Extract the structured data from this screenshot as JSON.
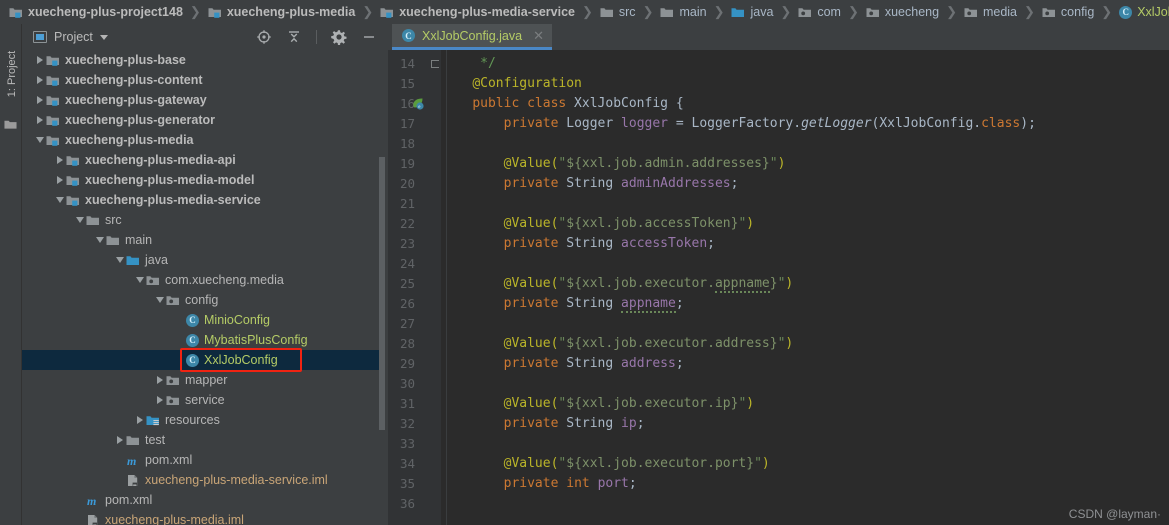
{
  "breadcrumb": [
    {
      "label": "xuecheng-plus-project148",
      "icon": "module-icon",
      "style": "bold"
    },
    {
      "label": "xuecheng-plus-media",
      "icon": "module-icon",
      "style": "bold"
    },
    {
      "label": "xuecheng-plus-media-service",
      "icon": "module-icon",
      "style": "bold"
    },
    {
      "label": "src",
      "icon": "folder-icon",
      "style": "plain"
    },
    {
      "label": "main",
      "icon": "folder-icon",
      "style": "plain"
    },
    {
      "label": "java",
      "icon": "source-folder-icon",
      "style": "plain"
    },
    {
      "label": "com",
      "icon": "package-icon",
      "style": "plain"
    },
    {
      "label": "xuecheng",
      "icon": "package-icon",
      "style": "plain"
    },
    {
      "label": "media",
      "icon": "package-icon",
      "style": "plain"
    },
    {
      "label": "config",
      "icon": "package-icon",
      "style": "plain"
    },
    {
      "label": "XxlJobConfig",
      "icon": "java-class-icon",
      "style": "cls"
    }
  ],
  "toolwindow_stripe": {
    "label": "1: Project",
    "folder_icon": "folder-icon"
  },
  "project_panel": {
    "title": "Project",
    "title_icon": "project-view-icon",
    "dropdown_icon": "chevron-down-icon",
    "toolbar_icons": [
      {
        "name": "locate-icon"
      },
      {
        "name": "collapse-all-icon"
      },
      {
        "name": "settings-gear-icon"
      },
      {
        "name": "hide-panel-icon"
      }
    ],
    "tree": [
      {
        "label": "xuecheng-plus-base",
        "indent": 0,
        "twisty": "right",
        "icon": "module-icon",
        "style": "bold",
        "clipped": true
      },
      {
        "label": "xuecheng-plus-content",
        "indent": 0,
        "twisty": "right",
        "icon": "module-icon",
        "style": "bold"
      },
      {
        "label": "xuecheng-plus-gateway",
        "indent": 0,
        "twisty": "right",
        "icon": "module-icon",
        "style": "bold"
      },
      {
        "label": "xuecheng-plus-generator",
        "indent": 0,
        "twisty": "right",
        "icon": "module-icon",
        "style": "bold"
      },
      {
        "label": "xuecheng-plus-media",
        "indent": 0,
        "twisty": "down",
        "icon": "module-icon",
        "style": "bold"
      },
      {
        "label": "xuecheng-plus-media-api",
        "indent": 1,
        "twisty": "right",
        "icon": "module-icon",
        "style": "bold"
      },
      {
        "label": "xuecheng-plus-media-model",
        "indent": 1,
        "twisty": "right",
        "icon": "module-icon",
        "style": "bold"
      },
      {
        "label": "xuecheng-plus-media-service",
        "indent": 1,
        "twisty": "down",
        "icon": "module-icon",
        "style": "bold"
      },
      {
        "label": "src",
        "indent": 2,
        "twisty": "down",
        "icon": "folder-icon",
        "style": "normal"
      },
      {
        "label": "main",
        "indent": 3,
        "twisty": "down",
        "icon": "folder-icon",
        "style": "normal"
      },
      {
        "label": "java",
        "indent": 4,
        "twisty": "down",
        "icon": "source-folder-icon",
        "style": "normal"
      },
      {
        "label": "com.xuecheng.media",
        "indent": 5,
        "twisty": "down",
        "icon": "package-icon",
        "style": "normal"
      },
      {
        "label": "config",
        "indent": 6,
        "twisty": "down",
        "icon": "package-icon",
        "style": "normal"
      },
      {
        "label": "MinioConfig",
        "indent": 7,
        "twisty": "none",
        "icon": "java-class-icon",
        "style": "cls"
      },
      {
        "label": "MybatisPlusConfig",
        "indent": 7,
        "twisty": "none",
        "icon": "java-class-icon",
        "style": "cls"
      },
      {
        "label": "XxlJobConfig",
        "indent": 7,
        "twisty": "none",
        "icon": "java-class-icon",
        "style": "cls",
        "selected": true,
        "highlighted": true
      },
      {
        "label": "mapper",
        "indent": 6,
        "twisty": "right",
        "icon": "package-icon",
        "style": "normal"
      },
      {
        "label": "service",
        "indent": 6,
        "twisty": "right",
        "icon": "package-icon",
        "style": "normal"
      },
      {
        "label": "resources",
        "indent": 5,
        "twisty": "right",
        "icon": "resource-folder-icon",
        "style": "normal"
      },
      {
        "label": "test",
        "indent": 4,
        "twisty": "right",
        "icon": "folder-icon",
        "style": "normal"
      },
      {
        "label": "pom.xml",
        "indent": 4,
        "twisty": "none",
        "icon": "maven-icon",
        "style": "xml"
      },
      {
        "label": "xuecheng-plus-media-service.iml",
        "indent": 4,
        "twisty": "none",
        "icon": "iml-icon",
        "style": "iml"
      },
      {
        "label": "pom.xml",
        "indent": 2,
        "twisty": "none",
        "icon": "maven-icon",
        "style": "xml"
      },
      {
        "label": "xuecheng-plus-media.iml",
        "indent": 2,
        "twisty": "none",
        "icon": "iml-icon",
        "style": "iml"
      }
    ]
  },
  "editor": {
    "tab": {
      "label": "XxlJobConfig.java",
      "icon": "java-class-icon",
      "close_icon": "close-icon",
      "active": true
    },
    "first_line_number": 14,
    "line_numbers": [
      14,
      15,
      16,
      17,
      18,
      19,
      20,
      21,
      22,
      23,
      24,
      25,
      26,
      27,
      28,
      29,
      30,
      31,
      32,
      33,
      34,
      35,
      36
    ],
    "gutter_markers": [
      {
        "line": 14,
        "type": "fold-end-marker"
      },
      {
        "line": 16,
        "type": "spring-bean-icon"
      }
    ],
    "lines": [
      {
        "n": 14,
        "tokens": [
          {
            "t": "     */",
            "c": "cmt"
          }
        ]
      },
      {
        "n": 15,
        "tokens": [
          {
            "t": "    ",
            "c": "pun"
          },
          {
            "t": "@Configuration",
            "c": "ann"
          }
        ]
      },
      {
        "n": 16,
        "tokens": [
          {
            "t": "    ",
            "c": "pun"
          },
          {
            "t": "public class",
            "c": "kw"
          },
          {
            "t": " XxlJobConfig ",
            "c": "typ"
          },
          {
            "t": "{",
            "c": "pun"
          }
        ]
      },
      {
        "n": 17,
        "tokens": [
          {
            "t": "        ",
            "c": "pun"
          },
          {
            "t": "private",
            "c": "kw"
          },
          {
            "t": " Logger ",
            "c": "typ"
          },
          {
            "t": "logger",
            "c": "fld"
          },
          {
            "t": " = ",
            "c": "pun"
          },
          {
            "t": "LoggerFactory.",
            "c": "typ"
          },
          {
            "t": "getLogger",
            "c": "mth"
          },
          {
            "t": "(XxlJobConfig.",
            "c": "typ"
          },
          {
            "t": "class",
            "c": "kw"
          },
          {
            "t": ");",
            "c": "pun"
          }
        ]
      },
      {
        "n": 18,
        "tokens": []
      },
      {
        "n": 19,
        "tokens": [
          {
            "t": "        ",
            "c": "pun"
          },
          {
            "t": "@Value(",
            "c": "ann"
          },
          {
            "t": "\"",
            "c": "str"
          },
          {
            "t": "${xxl.job.admin.addresses}",
            "c": "ph"
          },
          {
            "t": "\"",
            "c": "str"
          },
          {
            "t": ")",
            "c": "ann"
          }
        ]
      },
      {
        "n": 20,
        "tokens": [
          {
            "t": "        ",
            "c": "pun"
          },
          {
            "t": "private",
            "c": "kw"
          },
          {
            "t": " String ",
            "c": "typ"
          },
          {
            "t": "adminAddresses",
            "c": "fld"
          },
          {
            "t": ";",
            "c": "pun"
          }
        ]
      },
      {
        "n": 21,
        "tokens": []
      },
      {
        "n": 22,
        "tokens": [
          {
            "t": "        ",
            "c": "pun"
          },
          {
            "t": "@Value(",
            "c": "ann"
          },
          {
            "t": "\"",
            "c": "str"
          },
          {
            "t": "${xxl.job.accessToken}",
            "c": "ph"
          },
          {
            "t": "\"",
            "c": "str"
          },
          {
            "t": ")",
            "c": "ann"
          }
        ]
      },
      {
        "n": 23,
        "tokens": [
          {
            "t": "        ",
            "c": "pun"
          },
          {
            "t": "private",
            "c": "kw"
          },
          {
            "t": " String ",
            "c": "typ"
          },
          {
            "t": "accessToken",
            "c": "fld"
          },
          {
            "t": ";",
            "c": "pun"
          }
        ]
      },
      {
        "n": 24,
        "tokens": []
      },
      {
        "n": 25,
        "tokens": [
          {
            "t": "        ",
            "c": "pun"
          },
          {
            "t": "@Value(",
            "c": "ann"
          },
          {
            "t": "\"",
            "c": "str"
          },
          {
            "t": "${xxl.job.executor.",
            "c": "ph"
          },
          {
            "t": "appname",
            "c": "ph typo"
          },
          {
            "t": "}",
            "c": "ph"
          },
          {
            "t": "\"",
            "c": "str"
          },
          {
            "t": ")",
            "c": "ann"
          }
        ]
      },
      {
        "n": 26,
        "tokens": [
          {
            "t": "        ",
            "c": "pun"
          },
          {
            "t": "private",
            "c": "kw"
          },
          {
            "t": " String ",
            "c": "typ"
          },
          {
            "t": "appname",
            "c": "fld typo"
          },
          {
            "t": ";",
            "c": "pun"
          }
        ]
      },
      {
        "n": 27,
        "tokens": []
      },
      {
        "n": 28,
        "tokens": [
          {
            "t": "        ",
            "c": "pun"
          },
          {
            "t": "@Value(",
            "c": "ann"
          },
          {
            "t": "\"",
            "c": "str"
          },
          {
            "t": "${xxl.job.executor.address}",
            "c": "ph"
          },
          {
            "t": "\"",
            "c": "str"
          },
          {
            "t": ")",
            "c": "ann"
          }
        ]
      },
      {
        "n": 29,
        "tokens": [
          {
            "t": "        ",
            "c": "pun"
          },
          {
            "t": "private",
            "c": "kw"
          },
          {
            "t": " String ",
            "c": "typ"
          },
          {
            "t": "address",
            "c": "fld"
          },
          {
            "t": ";",
            "c": "pun"
          }
        ]
      },
      {
        "n": 30,
        "tokens": []
      },
      {
        "n": 31,
        "tokens": [
          {
            "t": "        ",
            "c": "pun"
          },
          {
            "t": "@Value(",
            "c": "ann"
          },
          {
            "t": "\"",
            "c": "str"
          },
          {
            "t": "${xxl.job.executor.ip}",
            "c": "ph"
          },
          {
            "t": "\"",
            "c": "str"
          },
          {
            "t": ")",
            "c": "ann"
          }
        ]
      },
      {
        "n": 32,
        "tokens": [
          {
            "t": "        ",
            "c": "pun"
          },
          {
            "t": "private",
            "c": "kw"
          },
          {
            "t": " String ",
            "c": "typ"
          },
          {
            "t": "ip",
            "c": "fld"
          },
          {
            "t": ";",
            "c": "pun"
          }
        ]
      },
      {
        "n": 33,
        "tokens": []
      },
      {
        "n": 34,
        "tokens": [
          {
            "t": "        ",
            "c": "pun"
          },
          {
            "t": "@Value(",
            "c": "ann"
          },
          {
            "t": "\"",
            "c": "str"
          },
          {
            "t": "${xxl.job.executor.port}",
            "c": "ph"
          },
          {
            "t": "\"",
            "c": "str"
          },
          {
            "t": ")",
            "c": "ann"
          }
        ]
      },
      {
        "n": 35,
        "tokens": [
          {
            "t": "        ",
            "c": "pun"
          },
          {
            "t": "private",
            "c": "kw"
          },
          {
            "t": " int ",
            "c": "kw"
          },
          {
            "t": "port",
            "c": "fld"
          },
          {
            "t": ";",
            "c": "pun"
          }
        ]
      },
      {
        "n": 36,
        "tokens": []
      }
    ]
  },
  "watermark": "CSDN @layman·",
  "colors": {
    "panel_bg": "#3c3f41",
    "editor_bg": "#2b2b2b",
    "gutter_bg": "#313335",
    "selection_bg": "#0d293e",
    "tab_active_underline": "#4a88c7",
    "annotation_red": "#f02312",
    "class_green": "#b5cc66",
    "keyword_orange": "#cc7832",
    "field_purple": "#9876aa",
    "string_green": "#6a8759",
    "annotation_yellow": "#bbb529",
    "iml_orange": "#c9a577",
    "text_gray": "#bbbbbb"
  }
}
